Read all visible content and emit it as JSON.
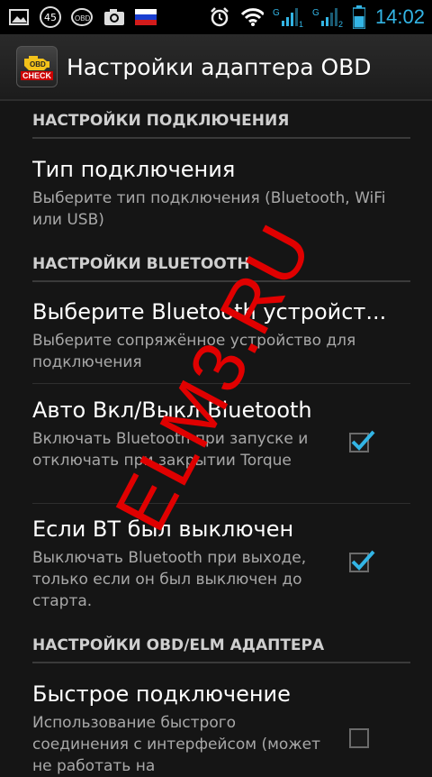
{
  "status_bar": {
    "notif_number": "45",
    "time": "14:02",
    "sim1_label": "1",
    "sim2_label": "2",
    "icons": [
      "gallery-icon",
      "badge-45-icon",
      "obd-icon",
      "camera-icon",
      "flag-ru-icon",
      "alarm-icon",
      "wifi-icon",
      "signal-sim1-icon",
      "signal-sim2-icon",
      "battery-icon"
    ]
  },
  "action_bar": {
    "title": "Настройки адаптера OBD",
    "icon_text_top": "OBD",
    "icon_text_bottom": "CHECK"
  },
  "sections": {
    "connection": {
      "header": "НАСТРОЙКИ ПОДКЛЮЧЕНИЯ"
    },
    "bluetooth": {
      "header": "НАСТРОЙКИ BLUETOOTH"
    },
    "obd": {
      "header": "НАСТРОЙКИ OBD/ELM АДАПТЕРА"
    }
  },
  "prefs": {
    "connection_type": {
      "title": "Тип подключения",
      "summary": "Выберите тип подключения (Bluetooth, WiFi или USB)"
    },
    "bt_device": {
      "title": "Выберите Bluetooth устройст...",
      "summary": "Выберите сопряжённое устройство для подключения"
    },
    "auto_bt": {
      "title": "Авто Вкл/Выкл Bluetooth",
      "summary": "Включать Bluetooth при запуске и отключать при закрытии Torque",
      "checked": true
    },
    "bt_was_off": {
      "title": "Если BT был выключен",
      "summary": "Выключать Bluetooth при выходе, только если он был выключен до старта.",
      "checked": true
    },
    "fast_connect": {
      "title": "Быстрое подключение",
      "summary": "Использование быстрого соединения с интерфейсом (может не работать на",
      "checked": false
    }
  },
  "watermark": "ELM3.RU",
  "colors": {
    "accent": "#33b5e5",
    "watermark": "#e00000",
    "background": "#151515"
  }
}
